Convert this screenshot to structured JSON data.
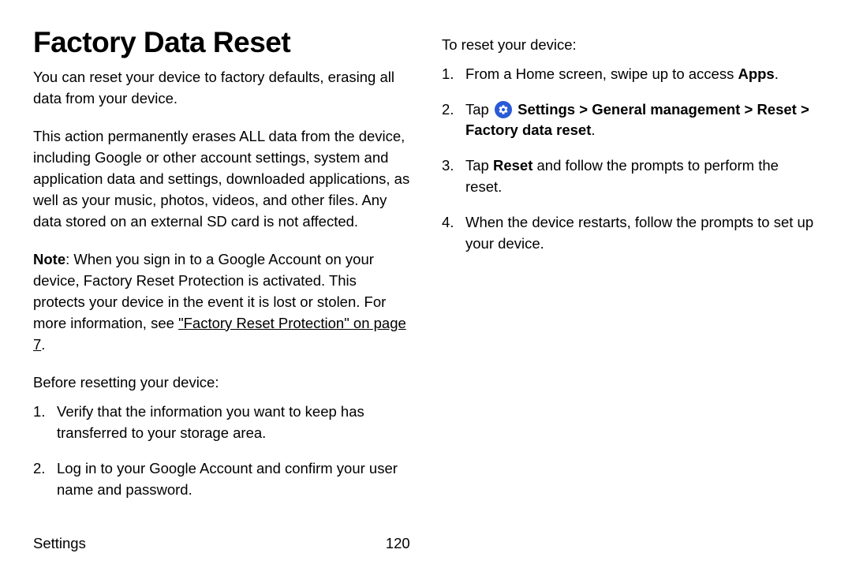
{
  "title": "Factory Data Reset",
  "left": {
    "intro": "You can reset your device to factory defaults, erasing all data from your device.",
    "warning": "This action permanently erases ALL data from the device, including Google or other account settings, system and application data and settings, downloaded applications, as well as your music, photos, videos, and other files. Any data stored on an external SD card is not affected.",
    "note_label": "Note",
    "note_body": ": When you sign in to a Google Account on your device, Factory Reset Protection is activated. This protects your device in the event it is lost or stolen. For more information, see ",
    "note_link": "\"Factory Reset Protection\" on page 7",
    "before_lead": "Before resetting your device:",
    "before_steps": [
      "Verify that the information you want to keep has transferred to your storage area.",
      "Log in to your Google Account and confirm your user name and password."
    ]
  },
  "right": {
    "reset_lead": "To reset your device:",
    "steps": {
      "s1_pre": "From a Home screen, swipe up to access ",
      "s1_bold": "Apps",
      "s1_post": ".",
      "s2_pre": "Tap ",
      "s2_path1": "Settings",
      "s2_sep": " > ",
      "s2_path2": "General management",
      "s2_path3": "Reset",
      "s2_path4": "Factory data reset",
      "s2_post": ".",
      "s3_pre": "Tap ",
      "s3_bold": "Reset",
      "s3_post": " and follow the prompts to perform the reset.",
      "s4": "When the device restarts, follow the prompts to set up your device."
    }
  },
  "footer": {
    "section": "Settings",
    "page": "120"
  }
}
